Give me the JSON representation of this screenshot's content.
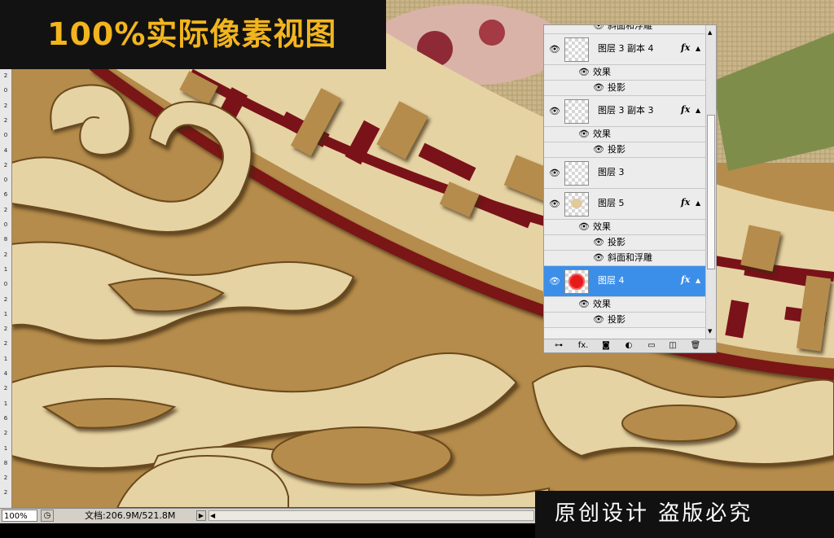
{
  "title_banner": {
    "text": "100%实际像素视图"
  },
  "rights_banner": {
    "text": "原创设计  盗版必究"
  },
  "status_bar": {
    "zoom": "100%",
    "doc_info": "文档:206.9M/521.8M",
    "menu_arrow": "▶",
    "scroll_left": "◀"
  },
  "ruler": {
    "labels": [
      "2",
      "0",
      "2",
      "2",
      "0",
      "4",
      "2",
      "0",
      "6",
      "2",
      "0",
      "8",
      "2",
      "1",
      "0",
      "2",
      "1",
      "2",
      "2",
      "1",
      "4",
      "2",
      "1",
      "6",
      "2",
      "1",
      "8",
      "2",
      "2"
    ]
  },
  "layers_panel": {
    "top_fx_row": "斜面和浮雕",
    "layers": [
      {
        "name": "图层 3 副本 4",
        "fx": "fx",
        "effects_label": "效果",
        "effects": [
          "投影"
        ]
      },
      {
        "name": "图层 3 副本 3",
        "fx": "fx",
        "effects_label": "效果",
        "effects": [
          "投影"
        ]
      },
      {
        "name": "图层 3"
      },
      {
        "name": "图层 5",
        "fx": "fx",
        "effects_label": "效果",
        "effects": [
          "投影",
          "斜面和浮雕"
        ]
      },
      {
        "name": "图层 4",
        "fx": "fx",
        "effects_label": "效果",
        "effects": [
          "投影"
        ],
        "selected": true
      }
    ],
    "eye_glyph": "👁",
    "expand_glyph": "▲",
    "footer_icons": [
      "link-icon",
      "fx-icon",
      "mask-icon",
      "adjustment-icon",
      "group-folder-icon",
      "new-layer-icon",
      "trash-icon"
    ],
    "footer_glyphs": [
      "⊶",
      "fx.",
      "◙",
      "◐",
      "▭",
      "◫",
      "🗑"
    ]
  },
  "colors": {
    "gold": "#b58c4b",
    "cream": "#e6d3a4",
    "maroon": "#7a1219",
    "selected": "#3c8fe8",
    "banner_text": "#f2b51e"
  }
}
